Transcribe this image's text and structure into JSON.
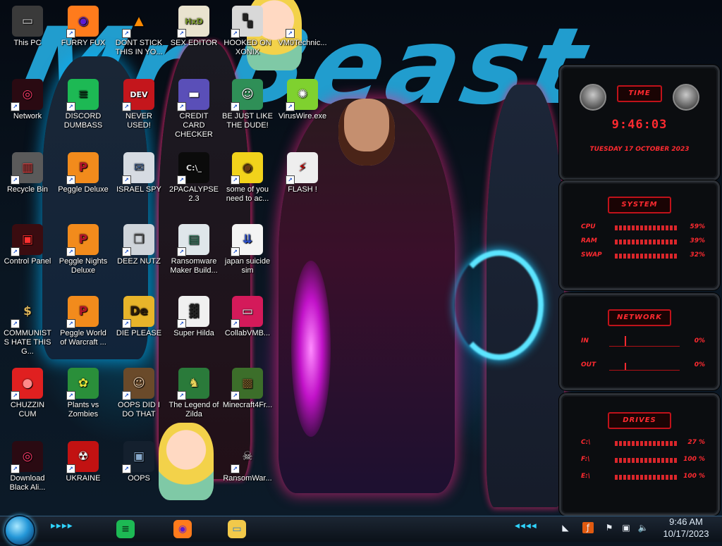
{
  "desktop": {
    "wallpaper_text": "Mr Beast",
    "icons": [
      {
        "label": "This PC",
        "icon": "computer-icon",
        "bg": "#3a3a3a",
        "glyph": "▭",
        "fg": "#ddd"
      },
      {
        "label": "FURRY FUX",
        "icon": "firefox-icon",
        "bg": "#ff7b1c",
        "glyph": "◉",
        "fg": "#5b1bd6"
      },
      {
        "label": "DONT STICK THIS IN YO...",
        "icon": "vlc-cone-icon",
        "bg": "transparent",
        "glyph": "▲",
        "fg": "#ff8a00"
      },
      {
        "label": "SEX EDITOR",
        "icon": "hex-editor-icon",
        "bg": "#e9e3cf",
        "glyph": "HxD",
        "fg": "#7a9a2a"
      },
      {
        "label": "HOOKED ON XONIX",
        "icon": "xonix-game-icon",
        "bg": "#d8d8d8",
        "glyph": "▚",
        "fg": "#222"
      },
      {
        "label": "VM0Technic...",
        "icon": "cartoon-girl-icon",
        "bg": "transparent",
        "glyph": "",
        "fg": "#fff"
      },
      {
        "label": "Network",
        "icon": "network-alien-icon",
        "bg": "#2a0a12",
        "glyph": "◎",
        "fg": "#ff3b6b"
      },
      {
        "label": "DISCORD DUMBASS",
        "icon": "spotify-green-icon",
        "bg": "#1db954",
        "glyph": "≡",
        "fg": "#0b3d1c"
      },
      {
        "label": "NEVER USED!",
        "icon": "devcpp-icon",
        "bg": "#c4161c",
        "glyph": "DEV",
        "fg": "#fff"
      },
      {
        "label": "CREDIT CARD CHECKER",
        "icon": "credit-card-icon",
        "bg": "#5a4fb8",
        "glyph": "▬",
        "fg": "#fff"
      },
      {
        "label": "BE JUST LIKE THE DUDE!",
        "icon": "santa-icon",
        "bg": "#2f8f57",
        "glyph": "☺",
        "fg": "#fff"
      },
      {
        "label": "VirusWire.exe",
        "icon": "lime-icon",
        "bg": "#7fd12f",
        "glyph": "✺",
        "fg": "#fff"
      },
      {
        "label": "Recycle Bin",
        "icon": "recycle-bin-icon",
        "bg": "#5a5a5a",
        "glyph": "▥",
        "fg": "#e44"
      },
      {
        "label": "Peggle Deluxe",
        "icon": "peggle-icon",
        "bg": "#f28b1c",
        "glyph": "P",
        "fg": "#b3142a"
      },
      {
        "label": "ISRAEL SPY",
        "icon": "spy-card-icon",
        "bg": "#d6dbe2",
        "glyph": "✉",
        "fg": "#3a5a8a"
      },
      {
        "label": "2PACALYPSE 2.3",
        "icon": "terminal-icon",
        "bg": "#0b0b0b",
        "glyph": "C:\\_",
        "fg": "#ddd"
      },
      {
        "label": "some of you need to ac...",
        "icon": "dog-icon",
        "bg": "#f2d31b",
        "glyph": "◉",
        "fg": "#6b3a14"
      },
      {
        "label": "FLASH !",
        "icon": "flash-file-icon",
        "bg": "#eee",
        "glyph": "⚡",
        "fg": "#c00"
      },
      {
        "label": "Control Panel",
        "icon": "control-panel-icon",
        "bg": "#3a0c10",
        "glyph": "▣",
        "fg": "#ff3030"
      },
      {
        "label": "Peggle Nights Deluxe",
        "icon": "peggle-nights-icon",
        "bg": "#f28b1c",
        "glyph": "P",
        "fg": "#b3142a"
      },
      {
        "label": "DEEZ NUTZ",
        "icon": "window-stack-icon",
        "bg": "#cfd4da",
        "glyph": "❒",
        "fg": "#555"
      },
      {
        "label": "Ransomware Maker Build...",
        "icon": "ransomware-app-icon",
        "bg": "#dfe6ea",
        "glyph": "▤",
        "fg": "#2a7a5a"
      },
      {
        "label": "japan suicide sim",
        "icon": "document-icon",
        "bg": "#f4f4f4",
        "glyph": "⇊",
        "fg": "#2a4ec9"
      },
      {
        "label": "COMMUNISTS HATE THIS G...",
        "icon": "money-bag-icon",
        "bg": "transparent",
        "glyph": "$",
        "fg": "#d9b35a"
      },
      {
        "label": "Peggle World of Warcraft ...",
        "icon": "peggle-wow-icon",
        "bg": "#f28b1c",
        "glyph": "P",
        "fg": "#b3142a"
      },
      {
        "label": "DIE PLEASE",
        "icon": "die-app-icon",
        "bg": "#e8b42a",
        "glyph": "De",
        "fg": "#2a1a0a"
      },
      {
        "label": "Super Hilda",
        "icon": "pixel-game-icon",
        "bg": "#f0f0f0",
        "glyph": "▓",
        "fg": "#222"
      },
      {
        "label": "CollabVMB...",
        "icon": "collab-vm-icon",
        "bg": "#d41a5a",
        "glyph": "▭",
        "fg": "#fff"
      },
      {
        "label": "CHUZZIN CUM",
        "icon": "chuzzle-icon",
        "bg": "#e02020",
        "glyph": "●",
        "fg": "#ff8a8a"
      },
      {
        "label": "Plants vs Zombies",
        "icon": "plants-icon",
        "bg": "#2a8f3a",
        "glyph": "✿",
        "fg": "#e6e33a"
      },
      {
        "label": "OOPS DID I DO THAT",
        "icon": "portrait-icon",
        "bg": "#6a4a2a",
        "glyph": "☺",
        "fg": "#e8c9a8"
      },
      {
        "label": "The Legend of Zilda",
        "icon": "zelda-sprite-icon",
        "bg": "#2a7a3a",
        "glyph": "♞",
        "fg": "#e8d35a"
      },
      {
        "label": "Minecraft4Fr...",
        "icon": "minecraft-block-icon",
        "bg": "#3c6e2a",
        "glyph": "▩",
        "fg": "#7a5a2a"
      },
      {
        "label": "Download Black Ali...",
        "icon": "alien-ware-icon",
        "bg": "#2a0a12",
        "glyph": "◎",
        "fg": "#ff3b6b"
      },
      {
        "label": "UKRAINE",
        "icon": "radiation-icon",
        "bg": "#c21212",
        "glyph": "☢",
        "fg": "#fff"
      },
      {
        "label": "OOPS",
        "icon": "alien-monitor-icon",
        "bg": "#14202e",
        "glyph": "▣",
        "fg": "#8ac"
      },
      {
        "label": "RansomWar...",
        "icon": "skull-icon",
        "bg": "transparent",
        "glyph": "☠",
        "fg": "#ddd"
      }
    ]
  },
  "gadget": {
    "time_panel": {
      "title": "TIME",
      "time": "9:46:03",
      "date": "TUESDAY 17 OCTOBER 2023"
    },
    "system_panel": {
      "title": "SYSTEM",
      "rows": [
        {
          "label": "CPU",
          "value": "59%"
        },
        {
          "label": "RAM",
          "value": "39%"
        },
        {
          "label": "SWAP",
          "value": "32%"
        }
      ]
    },
    "network_panel": {
      "title": "NETWORK",
      "rows": [
        {
          "label": "IN",
          "value": "0%"
        },
        {
          "label": "OUT",
          "value": "0%"
        }
      ]
    },
    "drives_panel": {
      "title": "DRIVES",
      "rows": [
        {
          "label": "C:\\",
          "value": "27 %"
        },
        {
          "label": "F:\\",
          "value": "100 %"
        },
        {
          "label": "E:\\",
          "value": "100 %"
        }
      ]
    }
  },
  "taskbar": {
    "pinned": [
      {
        "name": "spotify-taskbar-icon",
        "glyph": "≡",
        "bg": "#1db954",
        "fg": "#0b3d1c"
      },
      {
        "name": "firefox-taskbar-icon",
        "glyph": "◉",
        "bg": "#ff7b1c",
        "fg": "#5b1bd6"
      },
      {
        "name": "file-explorer-taskbar-icon",
        "glyph": "▭",
        "bg": "#f2c94a",
        "fg": "#2a7ac9"
      }
    ],
    "clock_time": "9:46 AM",
    "clock_date": "10/17/2023"
  },
  "colors": {
    "accent_red": "#ff2a30",
    "accent_cyan": "#2fd4ff",
    "wallpaper_blue": "#23a5d8"
  }
}
